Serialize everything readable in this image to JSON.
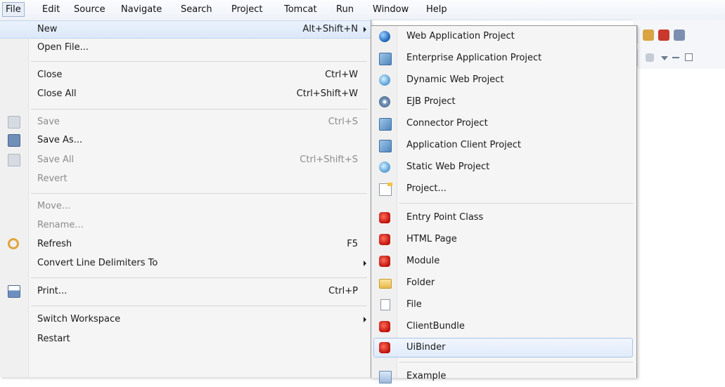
{
  "menubar": {
    "items": [
      "File",
      "Edit",
      "Source",
      "Navigate",
      "Search",
      "Project",
      "Tomcat",
      "Run",
      "Window",
      "Help"
    ]
  },
  "file_menu": {
    "new": {
      "label": "New",
      "shortcut": "Alt+Shift+N"
    },
    "open_file": {
      "label": "Open File..."
    },
    "close": {
      "label": "Close",
      "shortcut": "Ctrl+W"
    },
    "close_all": {
      "label": "Close All",
      "shortcut": "Ctrl+Shift+W"
    },
    "save": {
      "label": "Save",
      "shortcut": "Ctrl+S"
    },
    "save_as": {
      "label": "Save As..."
    },
    "save_all": {
      "label": "Save All",
      "shortcut": "Ctrl+Shift+S"
    },
    "revert": {
      "label": "Revert"
    },
    "move": {
      "label": "Move..."
    },
    "rename": {
      "label": "Rename..."
    },
    "refresh": {
      "label": "Refresh",
      "shortcut": "F5"
    },
    "convert": {
      "label": "Convert Line Delimiters To"
    },
    "print": {
      "label": "Print...",
      "shortcut": "Ctrl+P"
    },
    "switch_workspace": {
      "label": "Switch Workspace"
    },
    "restart": {
      "label": "Restart"
    }
  },
  "new_submenu": {
    "items": [
      {
        "label": "Web Application Project",
        "icon": "globe-icon"
      },
      {
        "label": "Enterprise Application Project",
        "icon": "enterprise-app-icon"
      },
      {
        "label": "Dynamic Web Project",
        "icon": "dynamic-web-icon"
      },
      {
        "label": "EJB Project",
        "icon": "ejb-icon"
      },
      {
        "label": "Connector Project",
        "icon": "connector-icon"
      },
      {
        "label": "Application Client Project",
        "icon": "app-client-icon"
      },
      {
        "label": "Static Web Project",
        "icon": "static-web-icon"
      },
      {
        "label": "Project...",
        "icon": "project-icon"
      },
      {
        "label": "Entry Point Class",
        "icon": "gwt-icon"
      },
      {
        "label": "HTML Page",
        "icon": "gwt-icon"
      },
      {
        "label": "Module",
        "icon": "gwt-icon"
      },
      {
        "label": "Folder",
        "icon": "folder-icon"
      },
      {
        "label": "File",
        "icon": "file-icon"
      },
      {
        "label": "ClientBundle",
        "icon": "gwt-icon"
      },
      {
        "label": "UiBinder",
        "icon": "gwt-icon"
      },
      {
        "label": "Example",
        "icon": "example-icon"
      }
    ]
  }
}
